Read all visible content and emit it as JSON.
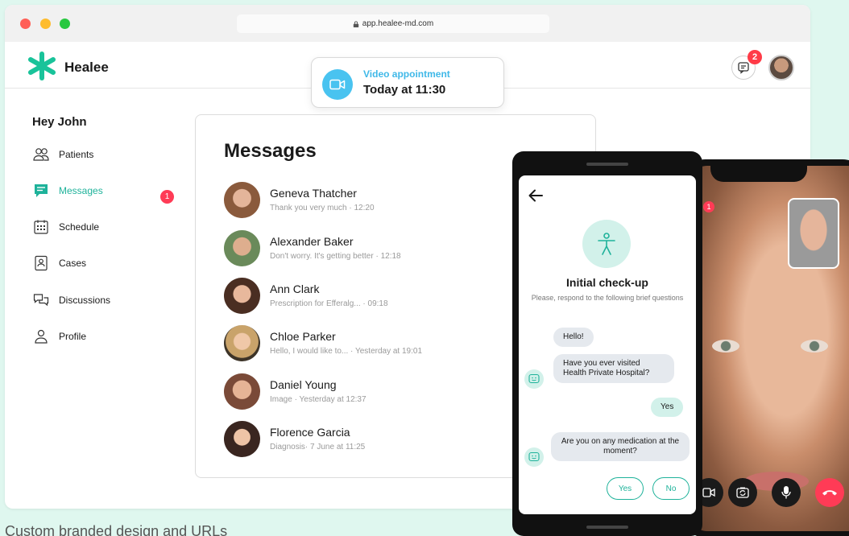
{
  "browser": {
    "url": "app.healee-md.com"
  },
  "header": {
    "brand": "Healee",
    "chat_badge": "2"
  },
  "notification": {
    "title": "Video appointment",
    "time": "Today at 11:30"
  },
  "sidebar": {
    "greeting": "Hey John",
    "items": [
      {
        "label": "Patients",
        "icon": "patients-icon"
      },
      {
        "label": "Messages",
        "icon": "messages-icon",
        "badge": "1",
        "active": true
      },
      {
        "label": "Schedule",
        "icon": "calendar-icon"
      },
      {
        "label": "Cases",
        "icon": "cases-icon"
      },
      {
        "label": "Discussions",
        "icon": "discussions-icon"
      },
      {
        "label": "Profile",
        "icon": "profile-icon"
      }
    ]
  },
  "messages": {
    "title": "Messages",
    "items": [
      {
        "name": "Geneva Thatcher",
        "preview": "Thank you very much  ·  12:20"
      },
      {
        "name": "Alexander Baker",
        "preview": "Don't worry. It's getting better  ·  12:18"
      },
      {
        "name": "Ann Clark",
        "preview": "Prescription for Efferalg...  ·  09:18"
      },
      {
        "name": "Chloe Parker",
        "preview": "Hello, I would like to...  ·  Yesterday at 19:01"
      },
      {
        "name": "Daniel Young",
        "preview": "Image  ·  Yesterday at 12:37"
      },
      {
        "name": "Florence Garcia",
        "preview": "Diagnosis·  7 June at 11:25"
      }
    ]
  },
  "checkup": {
    "title": "Initial check-up",
    "subtitle": "Please, respond to the following brief questions",
    "bubbles": {
      "hello": "Hello!",
      "q1": "Have you ever visited Health Private Hospital?",
      "a1": "Yes",
      "q2": "Are you on any medication at the moment?"
    },
    "reply_yes": "Yes",
    "reply_no": "No"
  },
  "video_call": {
    "badge": "1"
  },
  "caption": "Custom branded design and URLs",
  "colors": {
    "accent": "#1eb29a",
    "badge": "#ff3b56",
    "video_blue": "#49c3f0",
    "background": "#dff7ef"
  }
}
